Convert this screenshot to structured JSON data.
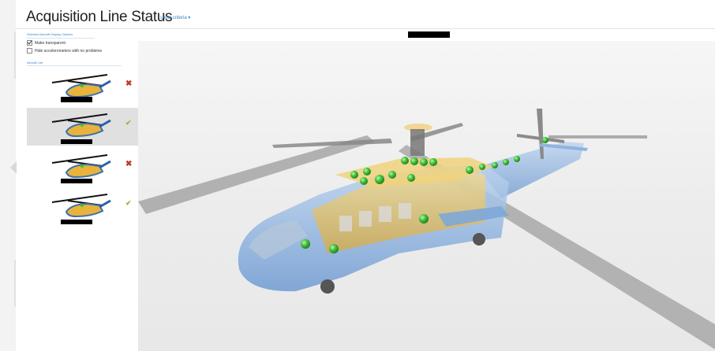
{
  "header": {
    "title": "Acquisition Line Status",
    "show_criteria": "show criteria ▾"
  },
  "sidebar": {
    "display_options_heading": "Selected Aircraft Display Options",
    "options": [
      {
        "label": "Make transparent",
        "checked": true
      },
      {
        "label": "Hide accelerometers with no problems",
        "checked": false
      }
    ],
    "aircraft_list_heading": "Aircraft List",
    "aircraft": [
      {
        "status": "error",
        "status_glyph": "✖",
        "selected": false
      },
      {
        "status": "ok",
        "status_glyph": "✔",
        "selected": true
      },
      {
        "status": "error",
        "status_glyph": "✖",
        "selected": false
      },
      {
        "status": "ok",
        "status_glyph": "✔",
        "selected": false
      }
    ]
  },
  "colors": {
    "accent": "#3d7fc7",
    "error": "#c0392b",
    "ok": "#8bbd3b",
    "sensor": "#3fbf3a",
    "fuselage_blue": "#8fb4de",
    "interior_yellow": "#e8c25a"
  }
}
